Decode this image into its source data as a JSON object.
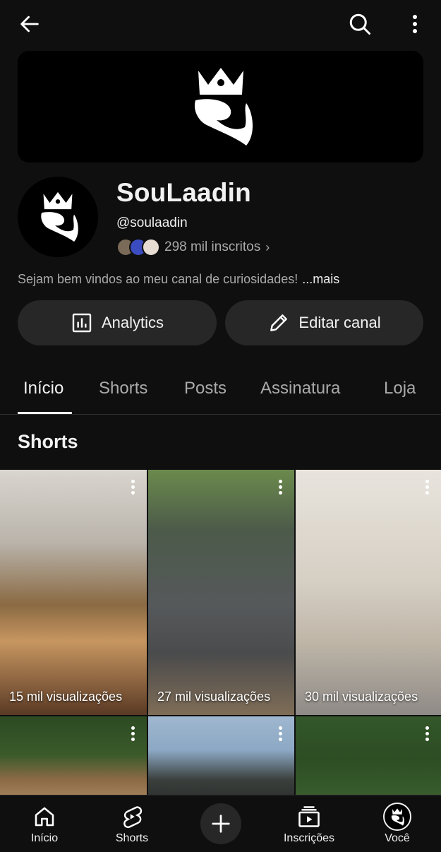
{
  "topbar": {
    "back_icon": "arrow-left-icon",
    "search_icon": "search-icon",
    "more_icon": "more-vert-icon"
  },
  "channel": {
    "name": "SouLaadin",
    "handle": "@soulaadin",
    "subscribers": "298 mil inscritos",
    "description": "Sejam bem vindos ao meu canal de curiosidades!",
    "description_more": "...mais"
  },
  "actions": {
    "analytics_label": "Analytics",
    "edit_label": "Editar canal"
  },
  "tabs": [
    {
      "label": "Início",
      "active": true
    },
    {
      "label": "Shorts",
      "active": false
    },
    {
      "label": "Posts",
      "active": false
    },
    {
      "label": "Assinatura",
      "active": false
    },
    {
      "label": "Loja",
      "active": false
    }
  ],
  "section": {
    "title": "Shorts"
  },
  "shorts": [
    {
      "views": "15 mil visualizações"
    },
    {
      "views": "27 mil visualizações"
    },
    {
      "views": "30 mil visualizações"
    },
    {
      "views": ""
    },
    {
      "views": ""
    },
    {
      "views": ""
    }
  ],
  "bottom_nav": [
    {
      "label": "Início",
      "icon": "home-icon"
    },
    {
      "label": "Shorts",
      "icon": "shorts-icon"
    },
    {
      "label": "",
      "icon": "create-plus-icon"
    },
    {
      "label": "Inscrições",
      "icon": "subscriptions-icon"
    },
    {
      "label": "Você",
      "icon": "you-avatar-icon"
    }
  ],
  "colors": {
    "background": "#0f0f0f",
    "surface": "#272727",
    "text_primary": "#f1f1f1",
    "text_secondary": "#aaaaaa"
  }
}
